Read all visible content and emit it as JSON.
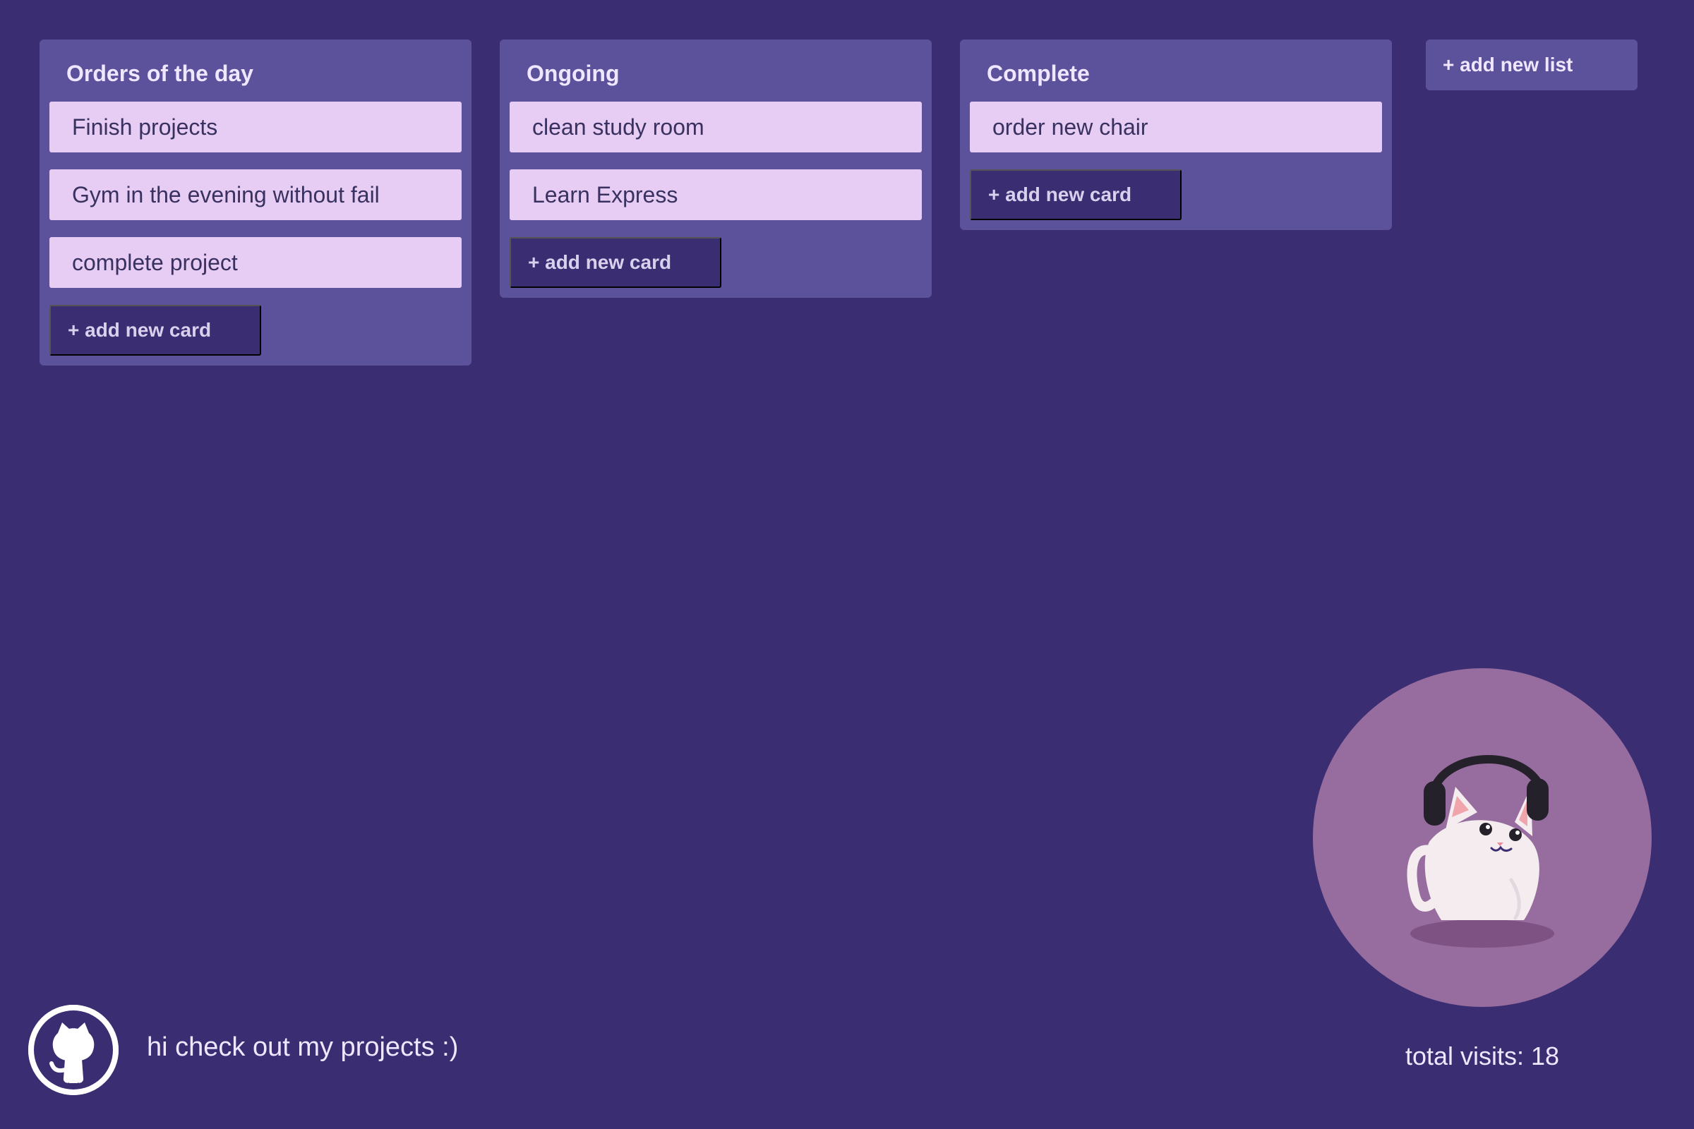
{
  "board": {
    "lists": [
      {
        "title": "Orders of the day",
        "cards": [
          "Finish projects",
          "Gym in the evening without fail",
          "complete project"
        ],
        "add_card_label": "+ add new card"
      },
      {
        "title": "Ongoing",
        "cards": [
          "clean study room",
          "Learn Express"
        ],
        "add_card_label": "+ add new card"
      },
      {
        "title": "Complete",
        "cards": [
          "order new chair"
        ],
        "add_card_label": "+ add new card"
      }
    ],
    "add_list_label": "+ add new list"
  },
  "footer": {
    "message": "hi check out my projects :)",
    "github_icon": "github-icon"
  },
  "visits": {
    "text": "total visits: 18"
  },
  "illustration": {
    "icon": "cat-with-headphones-icon"
  },
  "colors": {
    "background": "#3a2d72",
    "list_bg": "#5c519b",
    "card_bg": "#e7cdf4",
    "button_bg": "#3a2d72",
    "cat_circle_bg": "#976c9f"
  }
}
